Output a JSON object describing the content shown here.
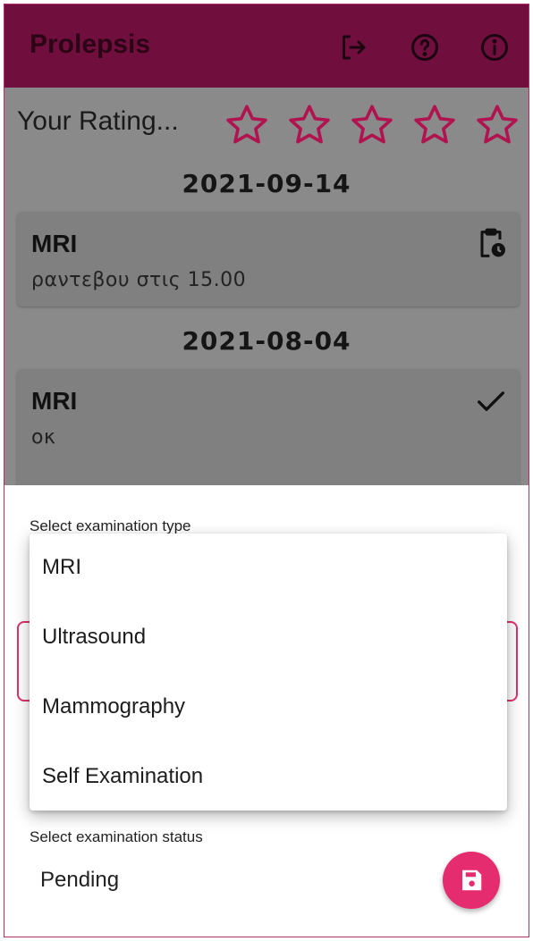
{
  "app": {
    "title": "Prolepsis",
    "accent": "#700f3d",
    "action_color": "#e52c6e",
    "icons": [
      "logout-icon",
      "help-icon",
      "info-icon"
    ]
  },
  "rating": {
    "label": "Your Rating...",
    "stars_total": 5,
    "stars_filled": 0
  },
  "entries": [
    {
      "date": "2021-09-14",
      "title": "MRI",
      "note": "ραντεβου στις 15.00",
      "status_icon": "clipboard-clock-icon"
    },
    {
      "date": "2021-08-04",
      "title": "MRI",
      "note": "οκ",
      "status_icon": "check-icon"
    }
  ],
  "form": {
    "type_label": "Select examination type",
    "type_options": [
      "MRI",
      "Ultrasound",
      "Mammography",
      "Self Examination"
    ],
    "status_label": "Select examination status",
    "status_value": "Pending",
    "save_icon": "save-icon"
  }
}
